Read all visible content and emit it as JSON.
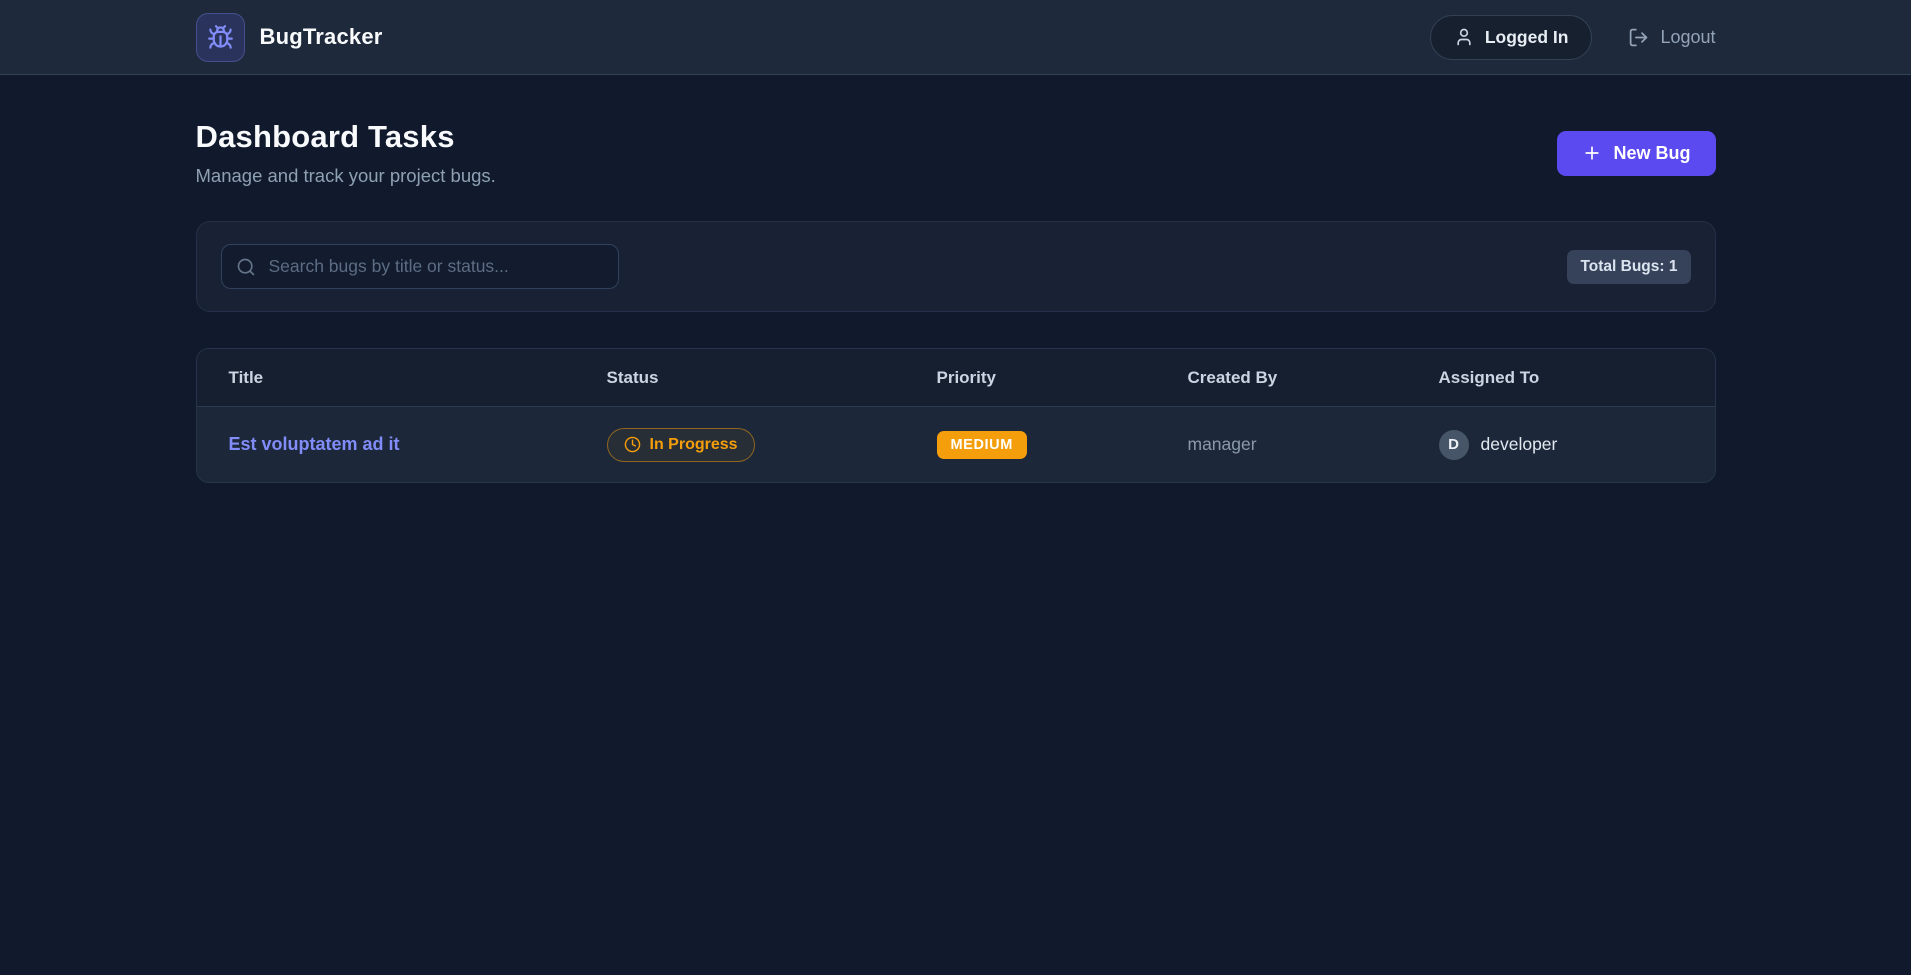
{
  "colors": {
    "accent": "#5b4af0",
    "status_amber": "#f59e0b",
    "title_link": "#818cf8",
    "navbar_bg": "#1e293b",
    "page_bg": "#101a2c"
  },
  "navbar": {
    "brand": "BugTracker",
    "logo_icon": "bug-icon",
    "logged_in": {
      "label": "Logged In",
      "icon": "user-icon"
    },
    "logout": {
      "label": "Logout",
      "icon": "logout-icon"
    }
  },
  "header": {
    "title": "Dashboard Tasks",
    "subtitle": "Manage and track your project bugs.",
    "new_bug": {
      "label": "New Bug",
      "icon": "plus-icon"
    }
  },
  "toolbar": {
    "search": {
      "placeholder": "Search bugs by title or status...",
      "value": "",
      "icon": "search-icon"
    },
    "total_badge": "Total Bugs: 1"
  },
  "table": {
    "headers": [
      "Title",
      "Status",
      "Priority",
      "Created By",
      "Assigned To"
    ],
    "rows": [
      {
        "title": "Est voluptatem ad it",
        "status": {
          "label": "In Progress",
          "icon": "clock-icon"
        },
        "priority": "MEDIUM",
        "created_by": "manager",
        "assigned_to": {
          "initial": "D",
          "name": "developer"
        }
      }
    ]
  }
}
